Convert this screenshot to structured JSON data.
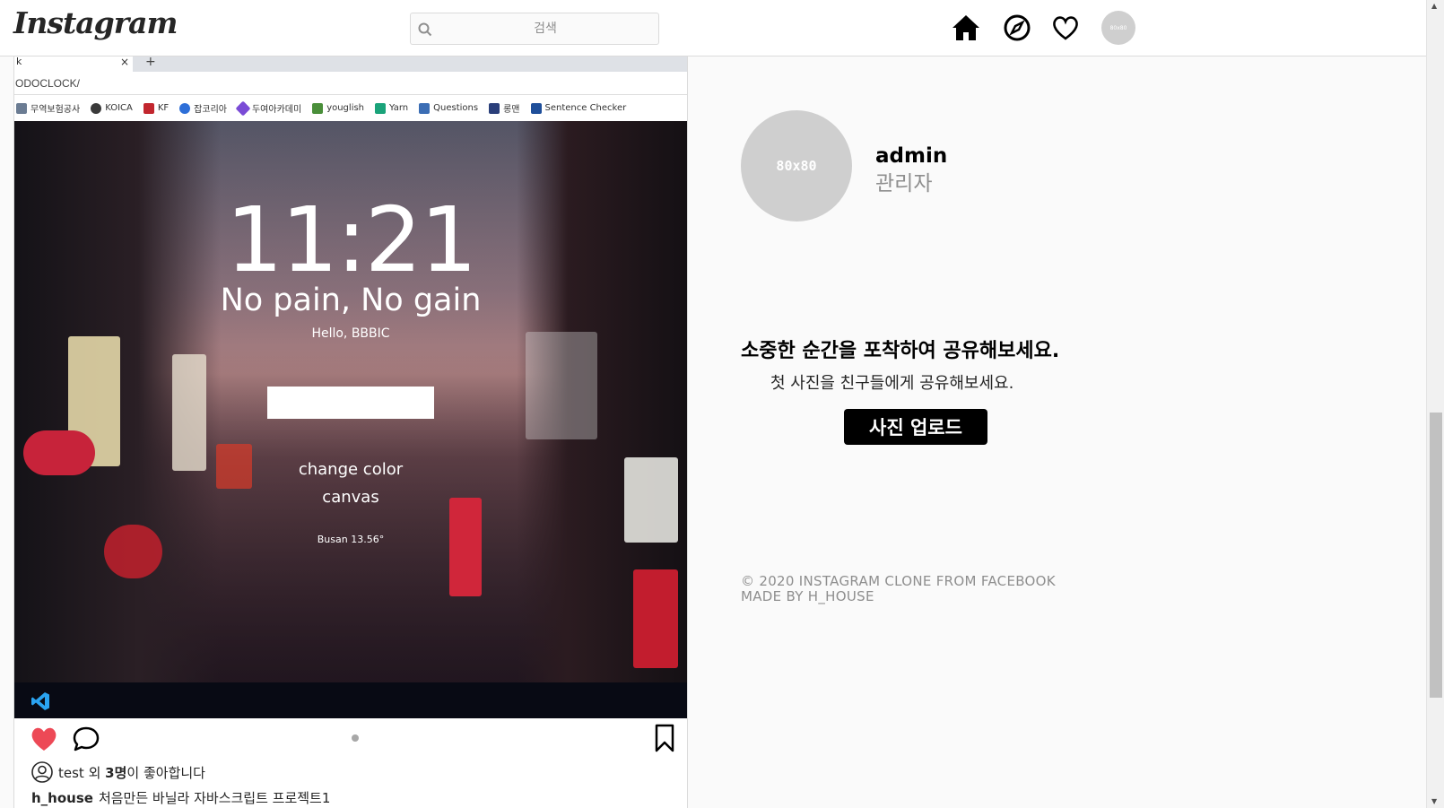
{
  "header": {
    "logo": "Instagram",
    "search_placeholder": "검색",
    "avatar_text": "80x80"
  },
  "post": {
    "screenshot": {
      "tab_title": "k",
      "tab_close": "×",
      "new_tab": "+",
      "address": "ODOCLOCK/",
      "bookmarks": [
        {
          "label": "무역보험공사",
          "color": "#6b7c93"
        },
        {
          "label": "KOICA",
          "color": "#3a3a3a"
        },
        {
          "label": "KF",
          "color": "#c2262e"
        },
        {
          "label": "잡코리아",
          "color": "#2e6fd8"
        },
        {
          "label": "두여아카데미",
          "color": "#7a4bd6"
        },
        {
          "label": "youglish",
          "color": "#4a8f3a"
        },
        {
          "label": "Yarn",
          "color": "#1aa37a"
        },
        {
          "label": "Questions",
          "color": "#3b6db4"
        },
        {
          "label": "롱맨",
          "color": "#2a3f7a"
        },
        {
          "label": "Sentence Checker",
          "color": "#1f4f9a"
        }
      ],
      "clock": "11:21",
      "motto": "No pain, No gain",
      "greeting": "Hello, BBBIC",
      "change_color": "change color",
      "canvas": "canvas",
      "weather": "Busan 13.56°"
    },
    "likes_user": "test",
    "likes_middle": " 외 ",
    "likes_count": "3명",
    "likes_suffix": "이 좋아합니다",
    "caption_user": "h_house",
    "caption_text": "처음만든 바닐라 자바스크립트 프로젝트1"
  },
  "sidebar": {
    "profile_pic_text": "80x80",
    "username": "admin",
    "fullname": "관리자",
    "promo_title": "소중한 순간을 포착하여 공유해보세요.",
    "promo_sub": "첫 사진을 친구들에게 공유해보세요.",
    "upload_label": "사진 업로드",
    "footer_line1": "© 2020 INSTAGRAM CLONE FROM FACEBOOK",
    "footer_line2": "MADE BY H_HOUSE"
  },
  "icons": {
    "home": "home-icon",
    "explore": "compass-icon",
    "activity": "heart-icon",
    "like": "heart-filled-icon",
    "comment": "comment-icon",
    "save": "bookmark-icon"
  },
  "colors": {
    "like_red": "#ed4956",
    "upload_bg": "#000000",
    "muted": "#8e8e8e"
  }
}
